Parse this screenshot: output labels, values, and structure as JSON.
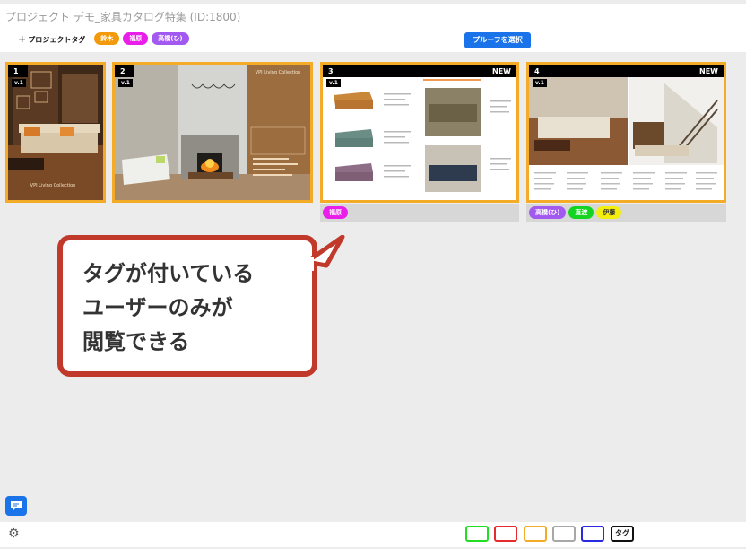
{
  "header": {
    "title": "プロジェクト デモ_家具カタログ特集 (ID:1800)",
    "add_tag_label": "プロジェクトタグ",
    "tags": [
      {
        "label": "鈴木",
        "color": "#f29a0b"
      },
      {
        "label": "福原",
        "color": "#e91ee8"
      },
      {
        "label": "高橋(ひ)",
        "color": "#a259f0"
      }
    ],
    "proof_button": "プルーフを選択"
  },
  "cards": [
    {
      "number": "1",
      "version": "v.1",
      "new": "",
      "tags": []
    },
    {
      "number": "2",
      "version": "v.1",
      "new": "",
      "tags": []
    },
    {
      "number": "3",
      "version": "v.1",
      "new": "NEW",
      "tags": [
        {
          "label": "福原",
          "color": "#e91ee8"
        }
      ]
    },
    {
      "number": "4",
      "version": "v.1",
      "new": "NEW",
      "tags": [
        {
          "label": "高橋(ひ)",
          "color": "#a259f0"
        },
        {
          "label": "直渡",
          "color": "#13d421"
        },
        {
          "label": "伊藤",
          "color": "#f3ee0e"
        }
      ]
    }
  ],
  "card_texts": {
    "collection_1": "VPI Living Collection",
    "collection_2": "VPI Living Collection"
  },
  "callout": {
    "line1": "タグが付いている",
    "line2": "ユーザーのみが",
    "line3": "閲覧できる"
  },
  "footer": {
    "swatches": [
      "#22dd22",
      "#e52b2b",
      "#f4ab28",
      "#a8a8a8",
      "#2a2ae0"
    ],
    "tag_key": "タグ"
  }
}
